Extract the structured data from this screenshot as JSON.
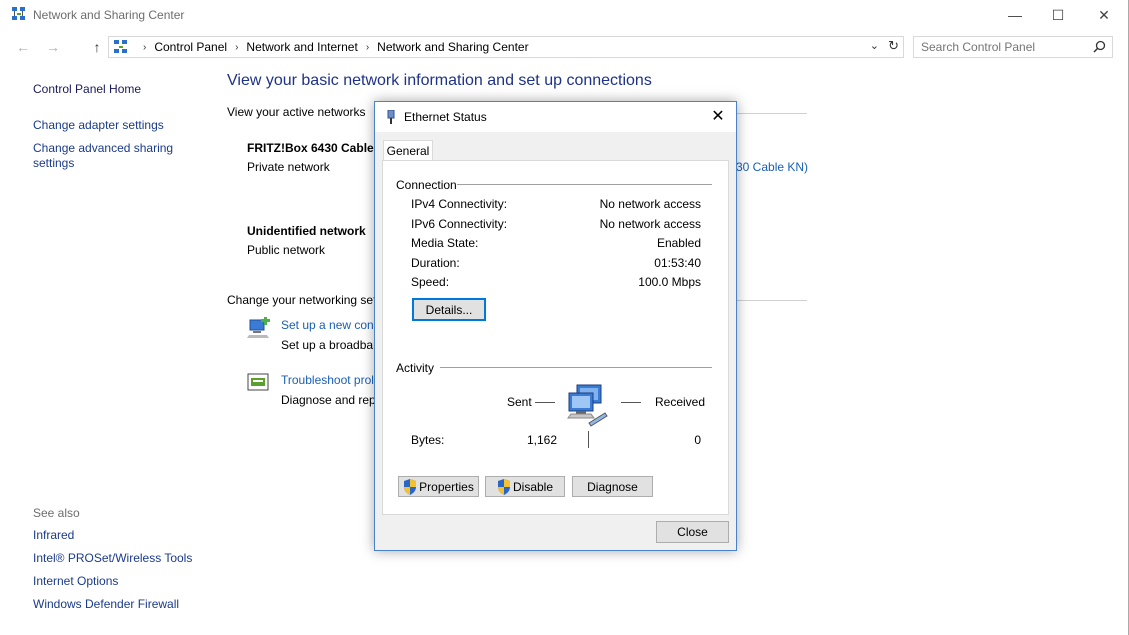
{
  "window": {
    "title": "Network and Sharing Center",
    "controls": {
      "minimize": "—",
      "maximize": "☐",
      "close": "✕"
    }
  },
  "nav": {
    "back": "←",
    "forward": "→",
    "up": "↑"
  },
  "address": {
    "crumbs": [
      "Control Panel",
      "Network and Internet",
      "Network and Sharing Center"
    ],
    "separator": "›",
    "dropdown": "⌄",
    "refresh": "↻"
  },
  "search": {
    "placeholder": "Search Control Panel"
  },
  "sidebar": {
    "home": "Control Panel Home",
    "links": [
      "Change adapter settings",
      "Change advanced sharing settings"
    ],
    "see_also": "See also",
    "see_also_links": [
      "Infrared",
      "Intel® PROSet/Wireless Tools",
      "Internet Options",
      "Windows Defender Firewall"
    ]
  },
  "main": {
    "title": "View your basic network information and set up connections",
    "active_networks_head": "View your active networks",
    "networks": [
      {
        "name": "FRITZ!Box 6430 Cable I",
        "type": "Private network",
        "connection": "30 Cable KN)"
      },
      {
        "name": "Unidentified network",
        "type": "Public network"
      }
    ],
    "change_head": "Change your networking set",
    "tasks": [
      {
        "link": "Set up a new conn",
        "desc": "Set up a broadbar"
      },
      {
        "link": "Troubleshoot prol",
        "desc": "Diagnose and rep"
      }
    ]
  },
  "dialog": {
    "title": "Ethernet Status",
    "close": "✕",
    "tab": "General",
    "connection": {
      "head": "Connection",
      "rows": [
        {
          "label": "IPv4 Connectivity:",
          "value": "No network access"
        },
        {
          "label": "IPv6 Connectivity:",
          "value": "No network access"
        },
        {
          "label": "Media State:",
          "value": "Enabled"
        },
        {
          "label": "Duration:",
          "value": "01:53:40"
        },
        {
          "label": "Speed:",
          "value": "100.0 Mbps"
        }
      ],
      "details_button": "Details..."
    },
    "activity": {
      "head": "Activity",
      "sent_label": "Sent",
      "received_label": "Received",
      "bytes_label": "Bytes:",
      "bytes_sent": "1,162",
      "bytes_received": "0"
    },
    "buttons": {
      "properties": "Properties",
      "disable": "Disable",
      "diagnose": "Diagnose"
    },
    "close_button": "Close"
  }
}
